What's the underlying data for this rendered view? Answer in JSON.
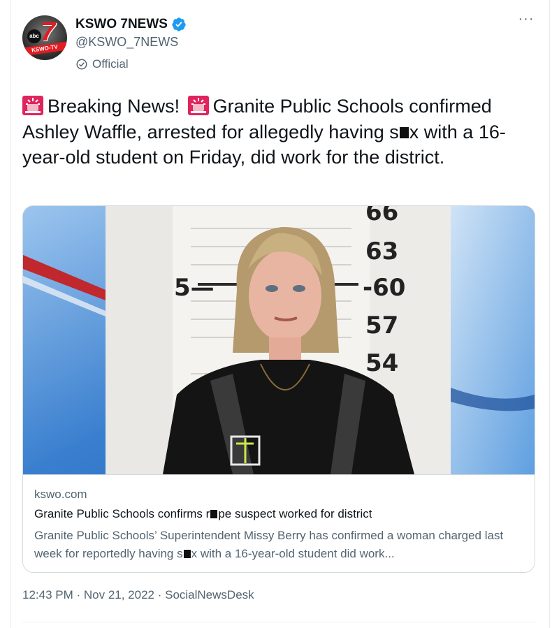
{
  "author": {
    "display_name": "KSWO 7NEWS",
    "handle": "@KSWO_7NEWS",
    "label": "Official",
    "avatar": {
      "abc": "abc",
      "number": "7",
      "band": "KSWO-TV"
    },
    "verified_color": "#1d9bf0"
  },
  "tweet": {
    "part1": "Breaking News!",
    "part2": "Granite Public Schools confirmed Ashley Waffle, arrested for allegedly having s",
    "part3": "x with a 16-year-old student on Friday, did work for the district.",
    "emoji": "police-siren-icon"
  },
  "card": {
    "domain": "kswo.com",
    "title_a": "Granite Public Schools confirms r",
    "title_b": "pe suspect worked for district",
    "desc_a": "Granite Public Schools’ Superintendent Missy Berry has confirmed a woman charged last week for reportedly having s",
    "desc_b": "x with a 16-year-old student did work...",
    "image": {
      "height_marks": [
        "66",
        "63",
        "60",
        "57",
        "54"
      ],
      "side_mark": "5"
    }
  },
  "meta": {
    "timestamp": "12:43 PM · Nov 21, 2022 · SocialNewsDesk"
  },
  "colors": {
    "accent": "#1d9bf0",
    "text": "#0f1419",
    "secondary": "#536471",
    "siren": "#e0245e"
  }
}
